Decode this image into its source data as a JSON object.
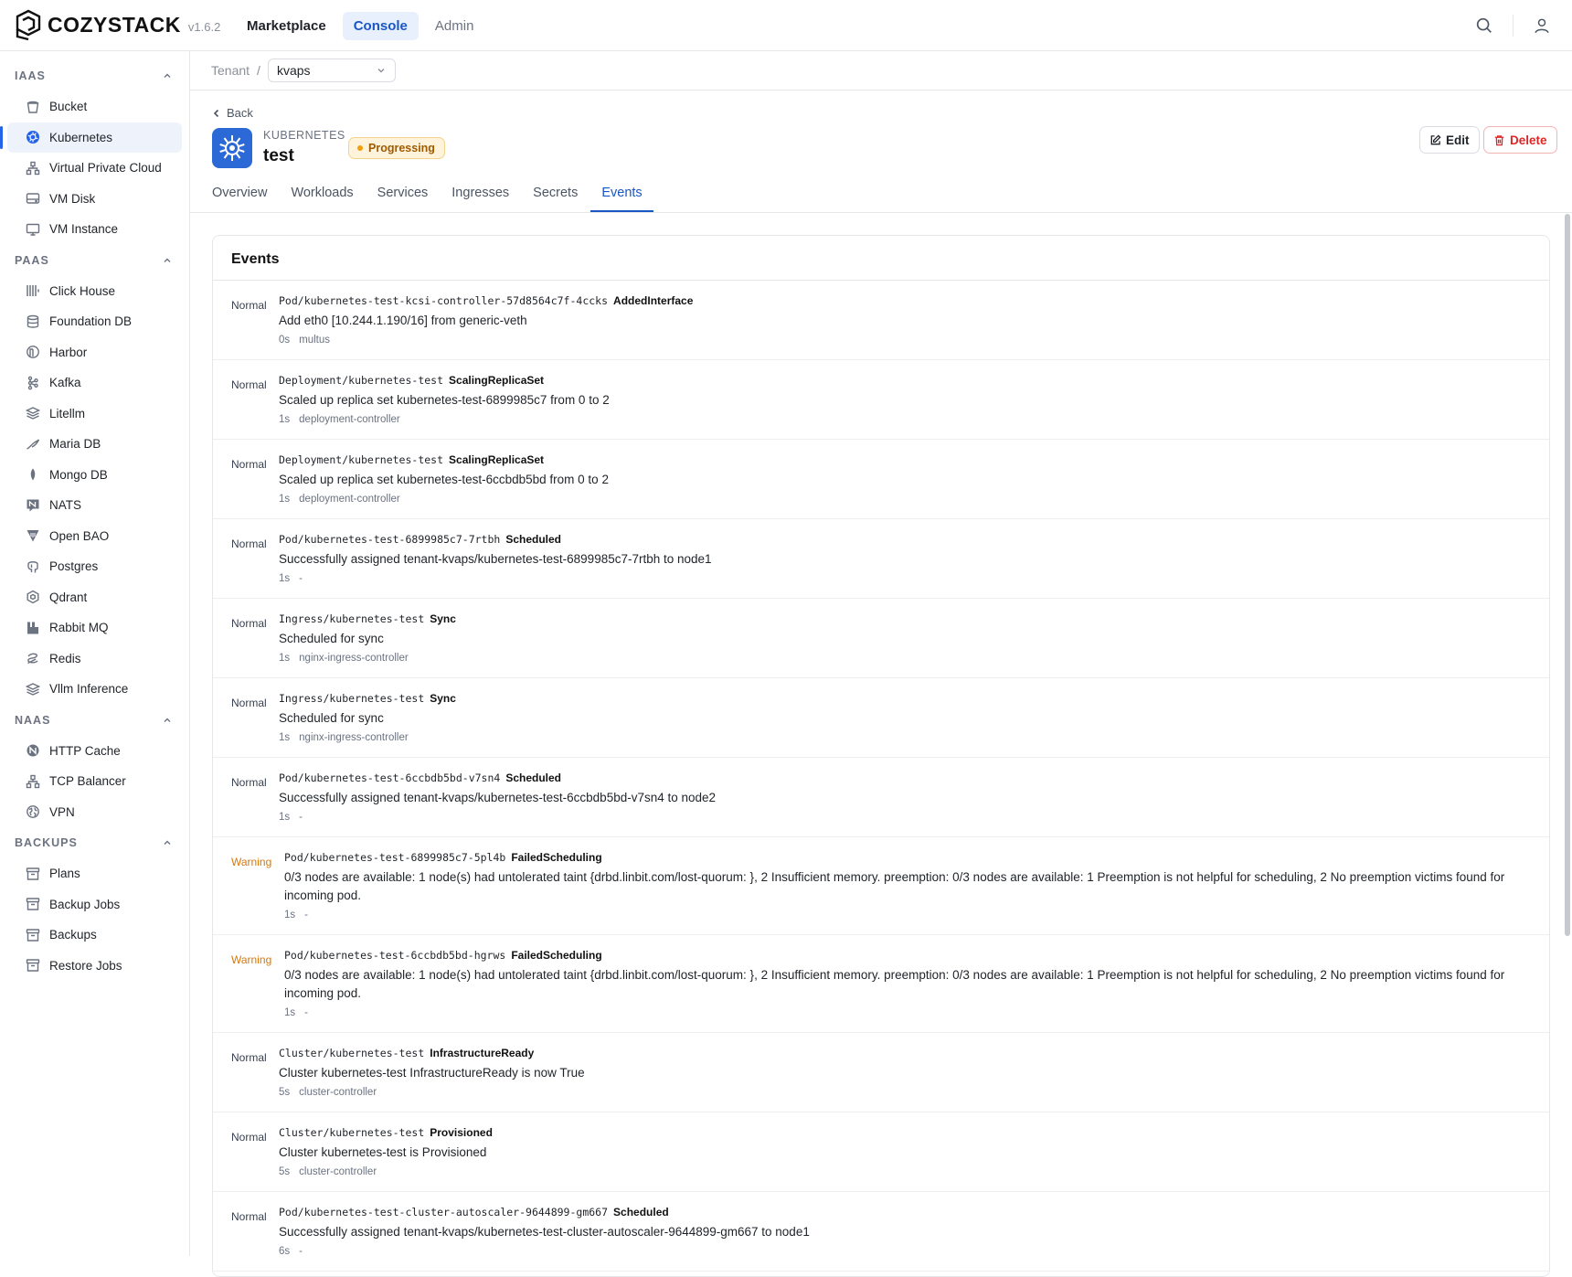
{
  "app": {
    "brand": "COZYSTACK",
    "version": "v1.6.2"
  },
  "topnav": [
    {
      "label": "Marketplace",
      "state": "normal"
    },
    {
      "label": "Console",
      "state": "active"
    },
    {
      "label": "Admin",
      "state": "muted"
    }
  ],
  "sidebar": {
    "sections": [
      {
        "title": "IAAS",
        "items": [
          {
            "label": "Bucket",
            "icon": "bucket-icon"
          },
          {
            "label": "Kubernetes",
            "icon": "kubernetes-icon",
            "active": true
          },
          {
            "label": "Virtual Private Cloud",
            "icon": "network-icon"
          },
          {
            "label": "VM Disk",
            "icon": "disk-icon"
          },
          {
            "label": "VM Instance",
            "icon": "monitor-icon"
          }
        ]
      },
      {
        "title": "PAAS",
        "items": [
          {
            "label": "Click House",
            "icon": "clickhouse-icon"
          },
          {
            "label": "Foundation DB",
            "icon": "database-icon"
          },
          {
            "label": "Harbor",
            "icon": "harbor-icon"
          },
          {
            "label": "Kafka",
            "icon": "kafka-icon"
          },
          {
            "label": "Litellm",
            "icon": "layers-icon"
          },
          {
            "label": "Maria DB",
            "icon": "mariadb-icon"
          },
          {
            "label": "Mongo DB",
            "icon": "leaf-icon"
          },
          {
            "label": "NATS",
            "icon": "nats-icon"
          },
          {
            "label": "Open BAO",
            "icon": "openbao-icon"
          },
          {
            "label": "Postgres",
            "icon": "elephant-icon"
          },
          {
            "label": "Qdrant",
            "icon": "qdrant-icon"
          },
          {
            "label": "Rabbit MQ",
            "icon": "rabbitmq-icon"
          },
          {
            "label": "Redis",
            "icon": "redis-icon"
          },
          {
            "label": "Vllm Inference",
            "icon": "layers-icon"
          }
        ]
      },
      {
        "title": "NAAS",
        "items": [
          {
            "label": "HTTP Cache",
            "icon": "cache-icon"
          },
          {
            "label": "TCP Balancer",
            "icon": "network-icon"
          },
          {
            "label": "VPN",
            "icon": "vpn-icon"
          }
        ]
      },
      {
        "title": "BACKUPS",
        "items": [
          {
            "label": "Plans",
            "icon": "archive-icon"
          },
          {
            "label": "Backup Jobs",
            "icon": "archive-icon"
          },
          {
            "label": "Backups",
            "icon": "archive-icon"
          },
          {
            "label": "Restore Jobs",
            "icon": "archive-icon"
          }
        ]
      }
    ]
  },
  "breadcrumb": {
    "root": "Tenant",
    "separator": "/",
    "tenant": "kvaps"
  },
  "header": {
    "back": "Back",
    "kind": "KUBERNETES",
    "name": "test",
    "status": "Progressing",
    "edit": "Edit",
    "delete": "Delete"
  },
  "tabs": [
    "Overview",
    "Workloads",
    "Services",
    "Ingresses",
    "Secrets",
    "Events"
  ],
  "active_tab": "Events",
  "events_title": "Events",
  "events": [
    {
      "type": "Normal",
      "object": "Pod/kubernetes-test-kcsi-controller-57d8564c7f-4ccks",
      "reason": "AddedInterface",
      "message": "Add eth0 [10.244.1.190/16] from generic-veth",
      "age": "0s",
      "source": "multus"
    },
    {
      "type": "Normal",
      "object": "Deployment/kubernetes-test",
      "reason": "ScalingReplicaSet",
      "message": "Scaled up replica set kubernetes-test-6899985c7 from 0 to 2",
      "age": "1s",
      "source": "deployment-controller"
    },
    {
      "type": "Normal",
      "object": "Deployment/kubernetes-test",
      "reason": "ScalingReplicaSet",
      "message": "Scaled up replica set kubernetes-test-6ccbdb5bd from 0 to 2",
      "age": "1s",
      "source": "deployment-controller"
    },
    {
      "type": "Normal",
      "object": "Pod/kubernetes-test-6899985c7-7rtbh",
      "reason": "Scheduled",
      "message": "Successfully assigned tenant-kvaps/kubernetes-test-6899985c7-7rtbh to node1",
      "age": "1s",
      "source": "-"
    },
    {
      "type": "Normal",
      "object": "Ingress/kubernetes-test",
      "reason": "Sync",
      "message": "Scheduled for sync",
      "age": "1s",
      "source": "nginx-ingress-controller"
    },
    {
      "type": "Normal",
      "object": "Ingress/kubernetes-test",
      "reason": "Sync",
      "message": "Scheduled for sync",
      "age": "1s",
      "source": "nginx-ingress-controller"
    },
    {
      "type": "Normal",
      "object": "Pod/kubernetes-test-6ccbdb5bd-v7sn4",
      "reason": "Scheduled",
      "message": "Successfully assigned tenant-kvaps/kubernetes-test-6ccbdb5bd-v7sn4 to node2",
      "age": "1s",
      "source": "-"
    },
    {
      "type": "Warning",
      "object": "Pod/kubernetes-test-6899985c7-5pl4b",
      "reason": "FailedScheduling",
      "message": "0/3 nodes are available: 1 node(s) had untolerated taint {drbd.linbit.com/lost-quorum: }, 2 Insufficient memory. preemption: 0/3 nodes are available: 1 Preemption is not helpful for scheduling, 2 No preemption victims found for incoming pod.",
      "age": "1s",
      "source": "-"
    },
    {
      "type": "Warning",
      "object": "Pod/kubernetes-test-6ccbdb5bd-hgrws",
      "reason": "FailedScheduling",
      "message": "0/3 nodes are available: 1 node(s) had untolerated taint {drbd.linbit.com/lost-quorum: }, 2 Insufficient memory. preemption: 0/3 nodes are available: 1 Preemption is not helpful for scheduling, 2 No preemption victims found for incoming pod.",
      "age": "1s",
      "source": "-"
    },
    {
      "type": "Normal",
      "object": "Cluster/kubernetes-test",
      "reason": "InfrastructureReady",
      "message": "Cluster kubernetes-test InfrastructureReady is now True",
      "age": "5s",
      "source": "cluster-controller"
    },
    {
      "type": "Normal",
      "object": "Cluster/kubernetes-test",
      "reason": "Provisioned",
      "message": "Cluster kubernetes-test is Provisioned",
      "age": "5s",
      "source": "cluster-controller"
    },
    {
      "type": "Normal",
      "object": "Pod/kubernetes-test-cluster-autoscaler-9644899-gm667",
      "reason": "Scheduled",
      "message": "Successfully assigned tenant-kvaps/kubernetes-test-cluster-autoscaler-9644899-gm667 to node1",
      "age": "6s",
      "source": "-"
    }
  ]
}
